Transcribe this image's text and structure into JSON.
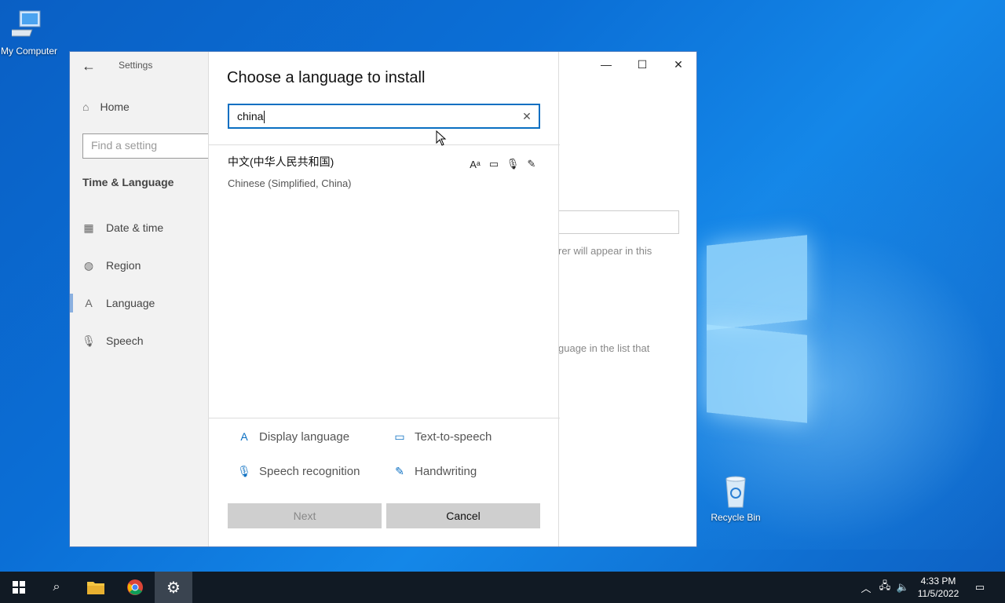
{
  "desktop": {
    "icons": [
      {
        "label": "My Computer",
        "icon": "computer-icon"
      },
      {
        "label": "Recycle Bin",
        "icon": "recycle-bin-icon"
      }
    ]
  },
  "settings": {
    "title": "Settings",
    "home_label": "Home",
    "search_placeholder": "Find a setting",
    "section_title": "Time & Language",
    "nav_items": [
      {
        "label": "Date & time",
        "icon": "calendar-clock-icon"
      },
      {
        "label": "Region",
        "icon": "globe-icon"
      },
      {
        "label": "Language",
        "icon": "language-icon"
      },
      {
        "label": "Speech",
        "icon": "microphone-icon"
      }
    ],
    "background_text_1": "rer will appear in this",
    "background_text_2": "guage in the list that"
  },
  "dialog": {
    "title": "Choose a language to install",
    "search_value": "china",
    "results": [
      {
        "native_name": "中文(中华人民共和国)",
        "english_name": "Chinese (Simplified, China)",
        "features": [
          "display-language-icon",
          "text-to-speech-icon",
          "speech-recognition-icon",
          "handwriting-icon"
        ]
      }
    ],
    "legend": {
      "display_language": "Display language",
      "text_to_speech": "Text-to-speech",
      "speech_recognition": "Speech recognition",
      "handwriting": "Handwriting"
    },
    "next_label": "Next",
    "cancel_label": "Cancel"
  },
  "taskbar": {
    "time": "4:33 PM",
    "date": "11/5/2022"
  },
  "colors": {
    "accent": "#0a6fc2",
    "taskbar": "#111a24",
    "button": "#cfcfcf"
  }
}
